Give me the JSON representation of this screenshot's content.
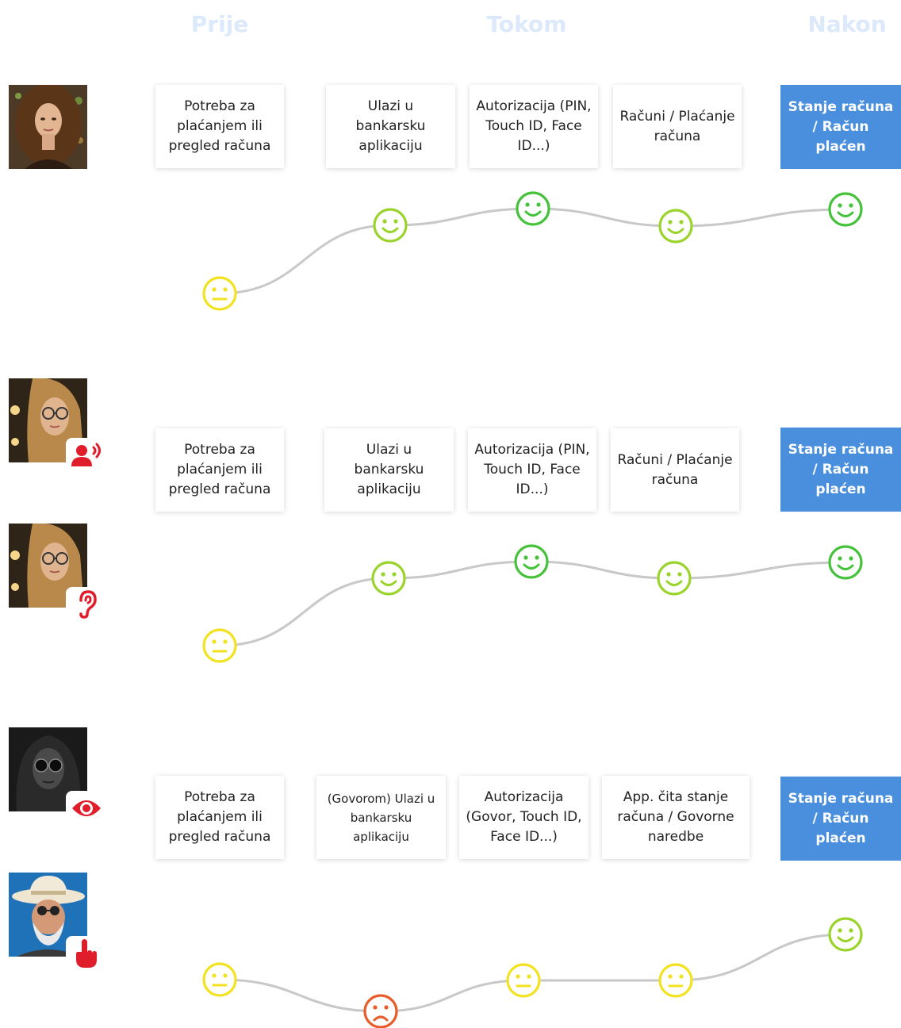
{
  "phases": {
    "before": "Prije",
    "during": "Tokom",
    "after": "Nakon"
  },
  "colors": {
    "curve": "#c8c8c8",
    "happy": "#44c23a",
    "content": "#9ad42a",
    "neutral": "#f2e21f",
    "sad": "#ea5b2a",
    "final_card": "#4a8fde",
    "badge_icon": "#e01e2b",
    "phase_label": "#dbe9fb"
  },
  "rows": [
    {
      "persona_icons": [],
      "steps": [
        "Potreba za plaćanjem ili pregled računa",
        "Ulazi u bankarsku aplikaciju",
        "Autorizacija (PIN, Touch ID, Face ID...)",
        "Računi / Plaćanje računa",
        "Stanje računa / Račun plaćen"
      ],
      "moods": [
        "neutral",
        "content",
        "happy",
        "content",
        "happy"
      ]
    },
    {
      "persona_icons": [
        "speaking-person-icon",
        "ear-icon"
      ],
      "steps": [
        "Potreba za plaćanjem ili pregled računa",
        "Ulazi u bankarsku aplikaciju",
        "Autorizacija (PIN, Touch ID, Face ID...)",
        "Računi / Plaćanje računa",
        "Stanje računa / Račun plaćen"
      ],
      "moods": [
        "neutral",
        "content",
        "happy",
        "content",
        "happy"
      ]
    },
    {
      "persona_icons": [
        "eye-icon",
        "touch-hand-icon"
      ],
      "steps": [
        "Potreba za plaćanjem ili pregled računa",
        "(Govorom) Ulazi u bankarsku aplikaciju",
        "Autorizacija (Govor, Touch ID, Face ID...)",
        "App. čita stanje računa / Govorne naredbe",
        "Stanje računa / Račun plaćen"
      ],
      "moods": [
        "neutral",
        "sad",
        "neutral",
        "neutral",
        "content"
      ]
    }
  ]
}
